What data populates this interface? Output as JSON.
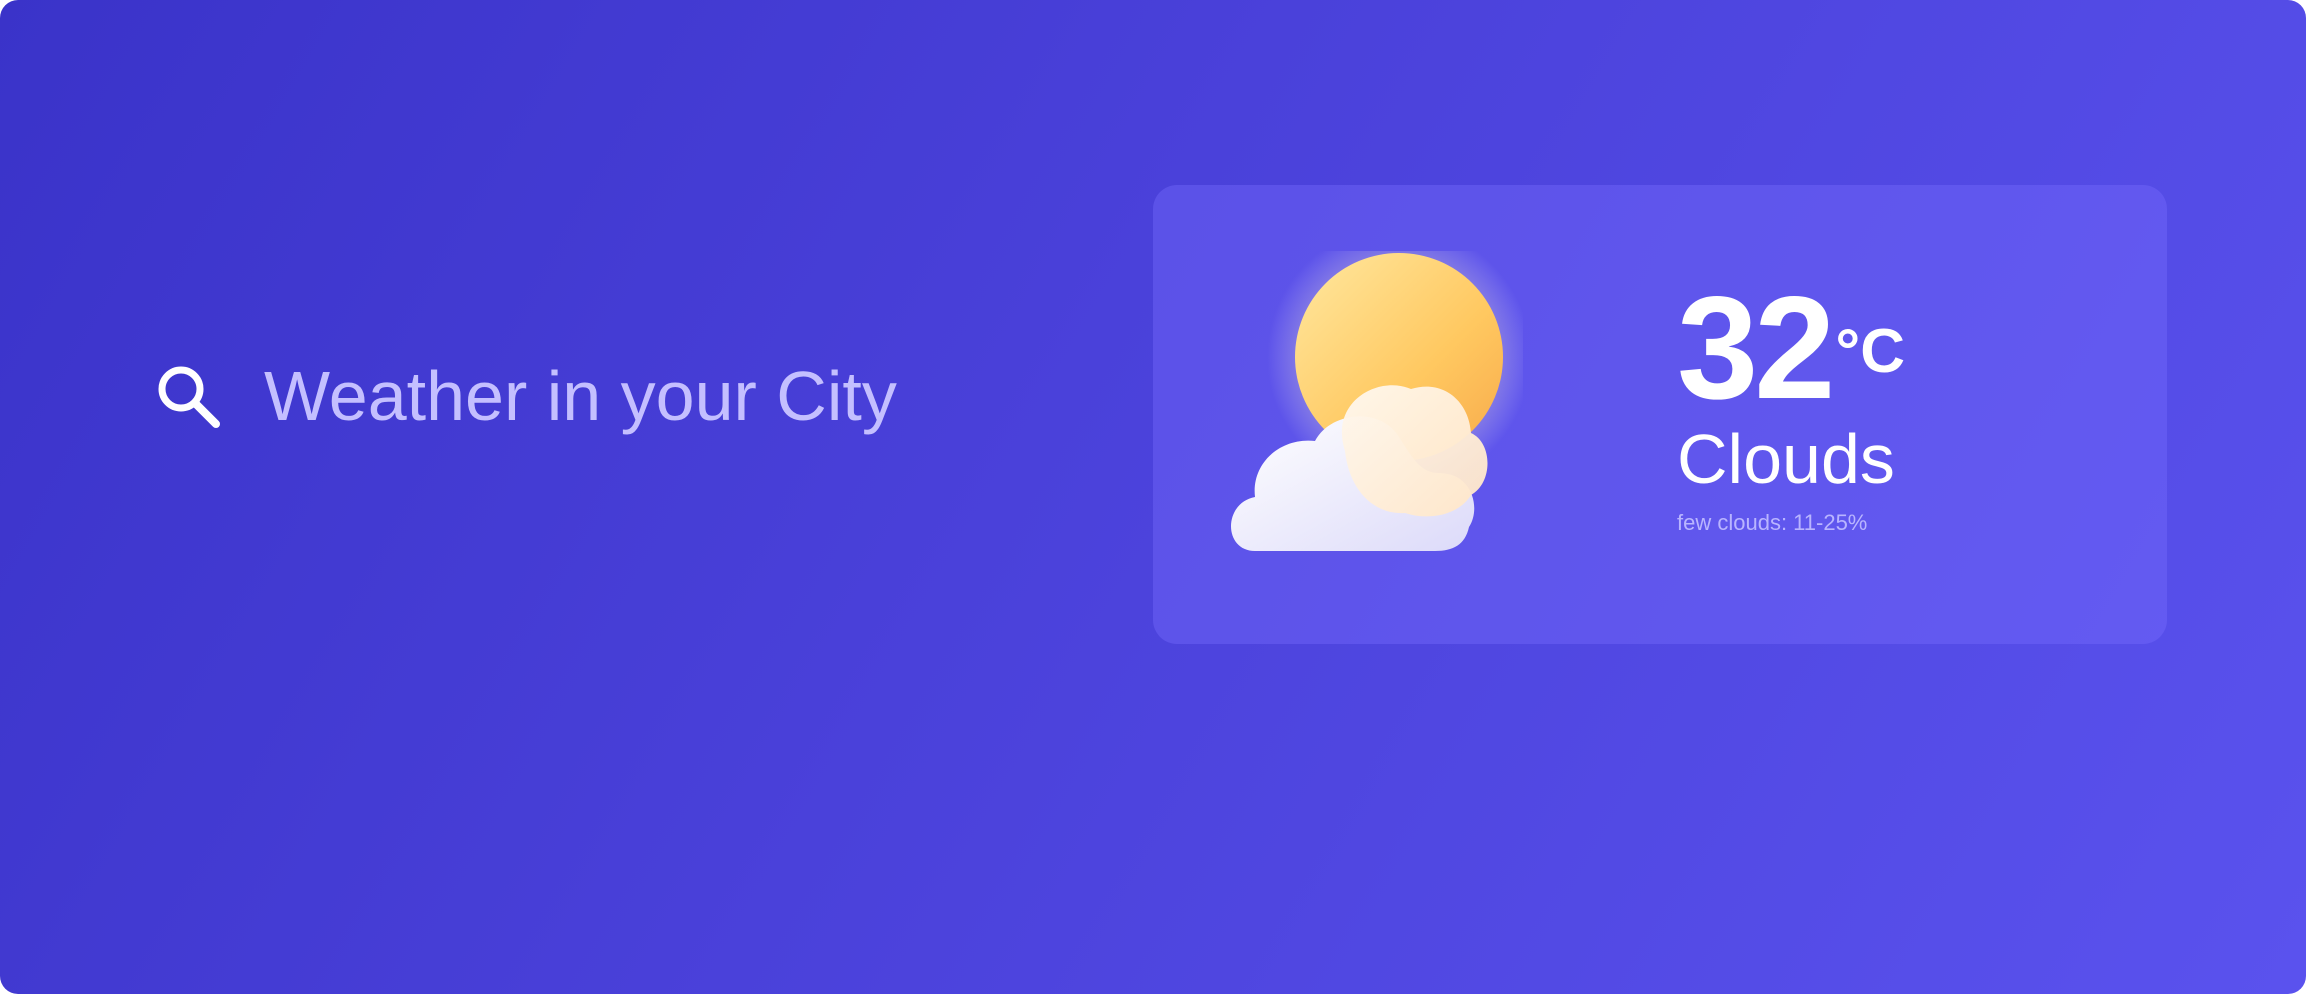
{
  "search": {
    "placeholder": "Weather in your City",
    "value": "",
    "icon": "search-icon"
  },
  "weather": {
    "icon": "partly-cloudy-icon",
    "temperature": "32",
    "unit": "°C",
    "condition": "Clouds",
    "description": "few clouds: 11-25%"
  },
  "colors": {
    "background_start": "#3a33c9",
    "background_end": "#5a52ee",
    "card": "#6e67f5",
    "text_primary": "#ffffff",
    "text_muted": "#c4bfff",
    "sun": "#ffc857"
  }
}
